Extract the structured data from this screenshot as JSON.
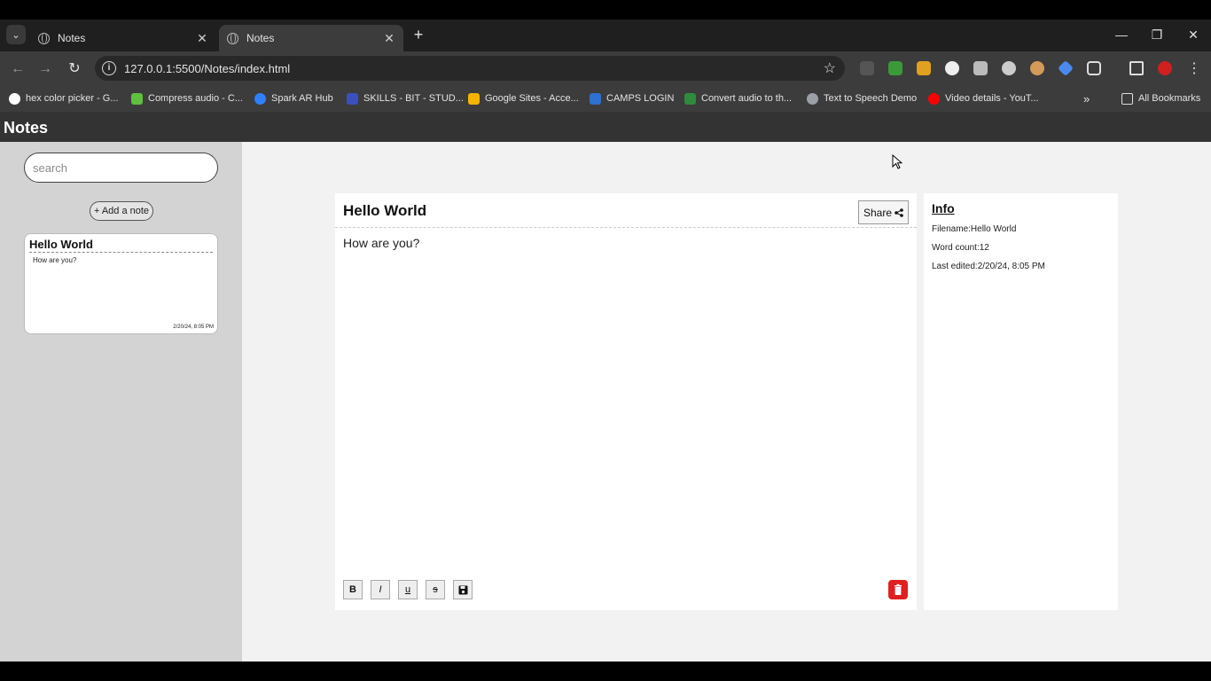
{
  "browser": {
    "tabs": [
      {
        "title": "Notes",
        "active": false
      },
      {
        "title": "Notes",
        "active": true
      }
    ],
    "url": "127.0.0.1:5500/Notes/index.html",
    "bookmarks": [
      {
        "label": "hex color picker - G...",
        "icon": "google-icon",
        "color": "#ffffff"
      },
      {
        "label": "Compress audio - C...",
        "icon": "compress-icon",
        "color": "#5fbf3f"
      },
      {
        "label": "Spark AR Hub",
        "icon": "meta-icon",
        "color": "#2f7fff"
      },
      {
        "label": "SKILLS - BIT - STUD...",
        "icon": "skills-icon",
        "color": "#3b4fbf"
      },
      {
        "label": "Google Sites - Acce...",
        "icon": "drive-icon",
        "color": "#f4b400"
      },
      {
        "label": "CAMPS LOGIN",
        "icon": "camps-icon",
        "color": "#2f6fd0"
      },
      {
        "label": "Convert audio to th...",
        "icon": "convert-icon",
        "color": "#2e8b3e"
      },
      {
        "label": "Text to Speech Demo",
        "icon": "globe-icon",
        "color": "#9aa0a6"
      },
      {
        "label": "Video details - YouT...",
        "icon": "youtube-icon",
        "color": "#ff0000"
      }
    ],
    "all_bookmarks_label": "All Bookmarks"
  },
  "app": {
    "title": "Notes",
    "search_placeholder": "search",
    "add_note_label": "+ Add a note",
    "notes": [
      {
        "title": "Hello World",
        "preview": "How are you?",
        "date": "2/20/24, 8:05 PM"
      }
    ],
    "editor": {
      "title": "Hello World",
      "share_label": "Share",
      "body": "How are you?",
      "format_buttons": [
        "B",
        "I",
        "u",
        "s"
      ]
    },
    "info": {
      "heading": "Info",
      "filename": "Filename:Hello World",
      "word_count": "Word count:12",
      "last_edited": "Last edited:2/20/24, 8:05 PM"
    }
  },
  "colors": {
    "sidebar_bg": "#d3d3d3",
    "header_bg": "#333333",
    "delete_red": "#e02020"
  }
}
